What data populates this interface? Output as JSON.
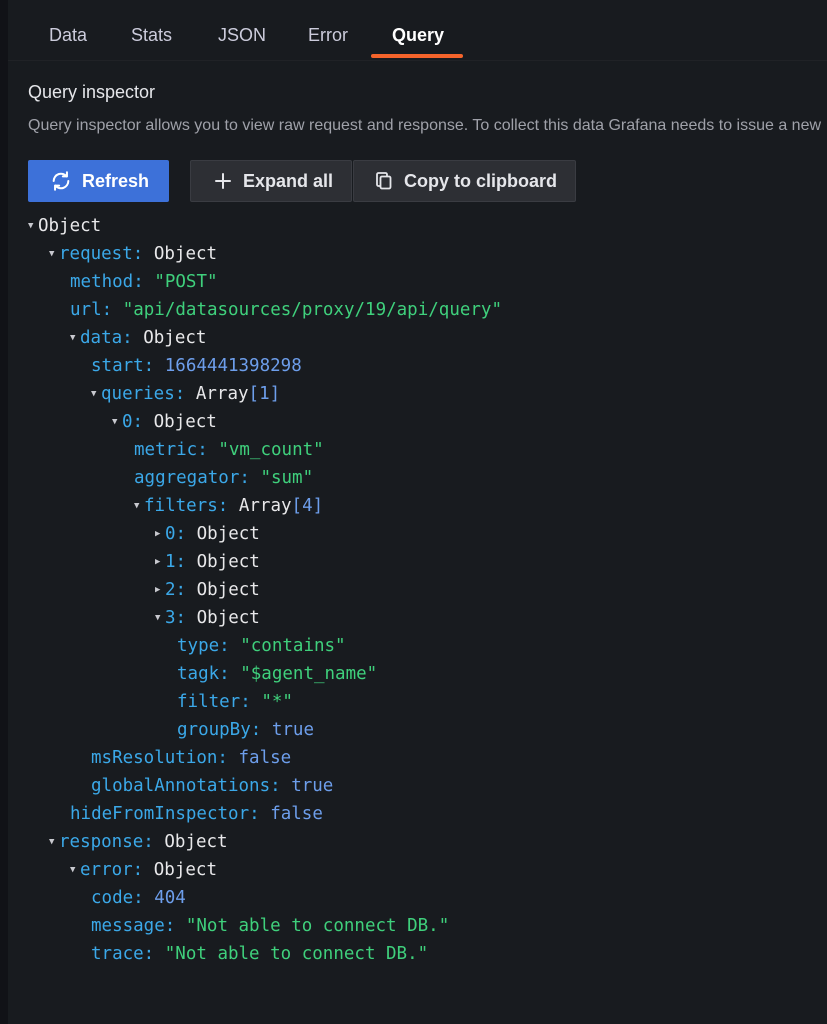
{
  "tabs": [
    {
      "label": "Data"
    },
    {
      "label": "Stats"
    },
    {
      "label": "JSON"
    },
    {
      "label": "Error"
    },
    {
      "label": "Query"
    }
  ],
  "active_tab": "Query",
  "section": {
    "title": "Query inspector",
    "description": "Query inspector allows you to view raw request and response. To collect this data Grafana needs to issue a new"
  },
  "buttons": {
    "refresh": "Refresh",
    "expand_all": "Expand all",
    "copy": "Copy to clipboard"
  },
  "icons": {
    "refresh": "sync-icon",
    "expand": "plus-icon",
    "copy": "copy-icon"
  },
  "tree": {
    "root": "Object",
    "request_key": "request:",
    "request_type": "Object",
    "method_key": "method:",
    "method_val": "\"POST\"",
    "url_key": "url:",
    "url_val": "\"api/datasources/proxy/19/api/query\"",
    "data_key": "data:",
    "data_type": "Object",
    "start_key": "start:",
    "start_val": "1664441398298",
    "queries_key": "queries:",
    "queries_type": "Array",
    "queries_count": "[1]",
    "q0_key": "0:",
    "q0_type": "Object",
    "metric_key": "metric:",
    "metric_val": "\"vm_count\"",
    "aggregator_key": "aggregator:",
    "aggregator_val": "\"sum\"",
    "filters_key": "filters:",
    "filters_type": "Array",
    "filters_count": "[4]",
    "f0_key": "0:",
    "f0_type": "Object",
    "f1_key": "1:",
    "f1_type": "Object",
    "f2_key": "2:",
    "f2_type": "Object",
    "f3_key": "3:",
    "f3_type": "Object",
    "type_key": "type:",
    "type_val": "\"contains\"",
    "tagk_key": "tagk:",
    "tagk_val": "\"$agent_name\"",
    "filter_key": "filter:",
    "filter_val": "\"*\"",
    "groupby_key": "groupBy:",
    "groupby_val": "true",
    "msres_key": "msResolution:",
    "msres_val": "false",
    "globalann_key": "globalAnnotations:",
    "globalann_val": "true",
    "hide_key": "hideFromInspector:",
    "hide_val": "false",
    "response_key": "response:",
    "response_type": "Object",
    "error_key": "error:",
    "error_type": "Object",
    "code_key": "code:",
    "code_val": "404",
    "message_key": "message:",
    "message_val": "\"Not able to connect DB.\"",
    "trace_key": "trace:",
    "trace_val": "\"Not able to connect DB.\""
  },
  "colors": {
    "accent": "#f5642b",
    "primary_button": "#3d71d9",
    "key": "#3ba8e8",
    "string": "#3fd07c",
    "number": "#6d9eeb"
  }
}
